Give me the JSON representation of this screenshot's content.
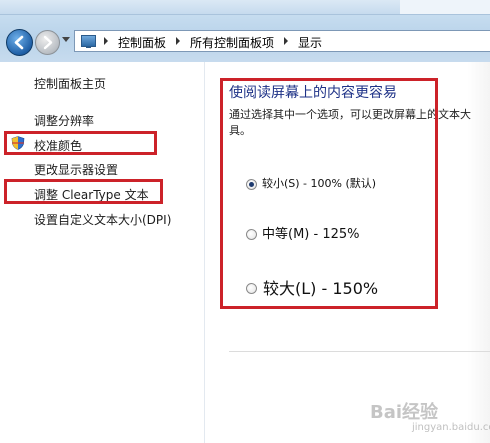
{
  "address_bar": {
    "crumbs": [
      "控制面板",
      "所有控制面板项",
      "显示"
    ]
  },
  "sidebar": {
    "home": "控制面板主页",
    "items": [
      {
        "label": "调整分辨率"
      },
      {
        "label": "校准颜色",
        "highlighted": true,
        "icon": "shield-icon"
      },
      {
        "label": "更改显示器设置"
      },
      {
        "label": "调整 ClearType 文本",
        "highlighted": true
      },
      {
        "label": "设置自定义文本大小(DPI)"
      }
    ]
  },
  "main": {
    "title": "使阅读屏幕上的内容更容易",
    "description": "通过选择其中一个选项，可以更改屏幕上的文本大",
    "description_cont": "具。",
    "options": [
      {
        "label": "较小(S) - 100% (默认)",
        "selected": true
      },
      {
        "label": "中等(M) - 125%",
        "selected": false
      },
      {
        "label": "较大(L) - 150%",
        "selected": false
      }
    ]
  },
  "watermark": {
    "text": "Bai经验",
    "sub": "jingyan.baidu.com"
  },
  "colors": {
    "highlight": "#cc2229",
    "title": "#1e3287"
  }
}
